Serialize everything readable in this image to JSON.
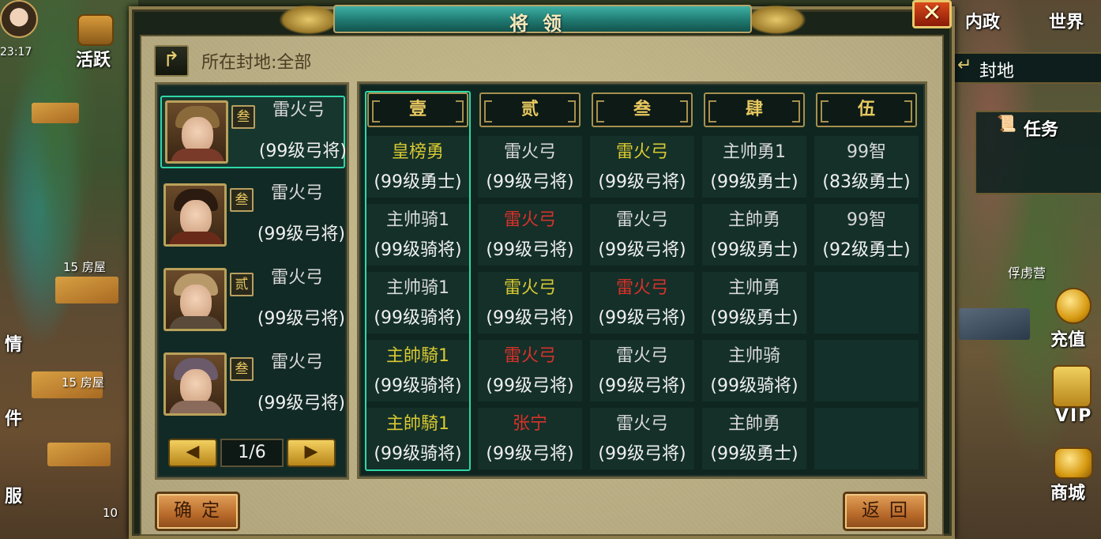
{
  "hud": {
    "time": "23:17",
    "huoyue": "活跃",
    "neizheng": "内政",
    "shijie": "世界",
    "fengdi": "封地",
    "renwu": "任务",
    "fulu_ying": "俘虏营",
    "chongzhi": "充值",
    "vip": "VIP",
    "shangcheng": "商城",
    "house_label_1": "15 房屋",
    "house_label_2": "15 房屋",
    "left_partial_1": "情",
    "left_partial_2": "件",
    "left_partial_3": "服",
    "left_partial_num": "10"
  },
  "dialog": {
    "title": "将领",
    "close_symbol": "✕",
    "location": "所在封地:全部",
    "confirm": "确定",
    "back": "返回"
  },
  "generals": [
    {
      "name": "雷火弓",
      "level": "(99级弓将)",
      "rank": "叁",
      "selected": true,
      "helm": "#8a6a3a",
      "body": "#7a3a2a"
    },
    {
      "name": "雷火弓",
      "level": "(99级弓将)",
      "rank": "叁",
      "selected": false,
      "helm": "#2a1a10",
      "body": "#6a2a1a"
    },
    {
      "name": "雷火弓",
      "level": "(99级弓将)",
      "rank": "贰",
      "selected": false,
      "helm": "#b89a6a",
      "body": "#5a4a3a"
    },
    {
      "name": "雷火弓",
      "level": "(99级弓将)",
      "rank": "叁",
      "selected": false,
      "helm": "#6a5a6a",
      "body": "#8a6a5a"
    }
  ],
  "pager": {
    "prev": "◀",
    "next": "▶",
    "page": "1/6"
  },
  "formation": {
    "columns": [
      "壹",
      "贰",
      "叁",
      "肆",
      "伍"
    ],
    "rows": [
      [
        {
          "name": "皇榜勇",
          "level": "(99级勇士)",
          "color": "#d8c832"
        },
        {
          "name": "雷火弓",
          "level": "(99级弓将)",
          "color": "#d8d8d8"
        },
        {
          "name": "雷火弓",
          "level": "(99级弓将)",
          "color": "#d8c832"
        },
        {
          "name": "主帅勇1",
          "level": "(99级勇士)",
          "color": "#d8d8d8"
        },
        {
          "name": "99智",
          "level": "(83级勇士)",
          "color": "#d8d8d8"
        }
      ],
      [
        {
          "name": "主帅骑1",
          "level": "(99级骑将)",
          "color": "#d8d8d8"
        },
        {
          "name": "雷火弓",
          "level": "(99级弓将)",
          "color": "#d8322a"
        },
        {
          "name": "雷火弓",
          "level": "(99级弓将)",
          "color": "#d8d8d8"
        },
        {
          "name": "主帥勇",
          "level": "(99级勇士)",
          "color": "#d8d8d8"
        },
        {
          "name": "99智",
          "level": "(92级勇士)",
          "color": "#d8d8d8"
        }
      ],
      [
        {
          "name": "主帅骑1",
          "level": "(99级骑将)",
          "color": "#d8d8d8"
        },
        {
          "name": "雷火弓",
          "level": "(99级弓将)",
          "color": "#d8c832"
        },
        {
          "name": "雷火弓",
          "level": "(99级弓将)",
          "color": "#d8322a"
        },
        {
          "name": "主帅勇",
          "level": "(99级勇士)",
          "color": "#d8d8d8"
        },
        null
      ],
      [
        {
          "name": "主帥騎1",
          "level": "(99级骑将)",
          "color": "#d8c832"
        },
        {
          "name": "雷火弓",
          "level": "(99级弓将)",
          "color": "#d8322a"
        },
        {
          "name": "雷火弓",
          "level": "(99级弓将)",
          "color": "#d8d8d8"
        },
        {
          "name": "主帅骑",
          "level": "(99级骑将)",
          "color": "#d8d8d8"
        },
        null
      ],
      [
        {
          "name": "主帥騎1",
          "level": "(99级骑将)",
          "color": "#d8c832"
        },
        {
          "name": "张宁",
          "level": "(99级弓将)",
          "color": "#d8322a"
        },
        {
          "name": "雷火弓",
          "level": "(99级弓将)",
          "color": "#d8d8d8"
        },
        {
          "name": "主帥勇",
          "level": "(99级勇士)",
          "color": "#d8d8d8"
        },
        null
      ]
    ]
  },
  "colors": {
    "accent_teal": "#2fd7a8",
    "name_yellow": "#d8c832",
    "name_red": "#d8322a",
    "name_white": "#d8d8d8",
    "frame_gold": "#a6904e"
  }
}
